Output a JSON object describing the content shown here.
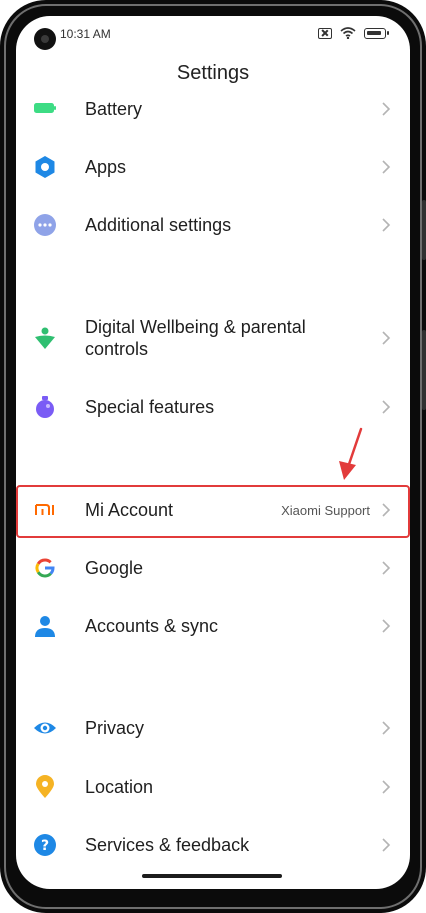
{
  "status_bar": {
    "time": "10:31 AM",
    "icons": [
      "sim-slot-icon",
      "wifi-icon",
      "battery-icon"
    ]
  },
  "header": {
    "title": "Settings"
  },
  "settings": {
    "items": [
      {
        "label": "Battery",
        "icon": "battery-icon",
        "icon_color": "#3ddc84"
      },
      {
        "label": "Apps",
        "icon": "gear-icon",
        "icon_color": "#1e88e5"
      },
      {
        "label": "Additional settings",
        "icon": "more-dots-icon",
        "icon_color": "#8fa3e8"
      },
      {
        "label": "Digital Wellbeing & parental controls",
        "icon": "wellbeing-icon",
        "icon_color": "#2fbf71"
      },
      {
        "label": "Special features",
        "icon": "special-features-icon",
        "icon_color": "#7a5cf5"
      },
      {
        "label": "Mi Account",
        "value": "Xiaomi Support",
        "icon": "mi-logo-icon",
        "icon_color": "#ff6900"
      },
      {
        "label": "Google",
        "icon": "google-g-icon",
        "icon_color": "#4285f4"
      },
      {
        "label": "Accounts & sync",
        "icon": "person-icon",
        "icon_color": "#1e88e5"
      },
      {
        "label": "Privacy",
        "icon": "eye-icon",
        "icon_color": "#1e88e5"
      },
      {
        "label": "Location",
        "icon": "location-pin-icon",
        "icon_color": "#f5b324"
      },
      {
        "label": "Services & feedback",
        "icon": "help-icon",
        "icon_color": "#1e88e5"
      }
    ]
  },
  "annotation": {
    "highlight_color": "#e23b3b",
    "arrow_color": "#e23b3b"
  }
}
